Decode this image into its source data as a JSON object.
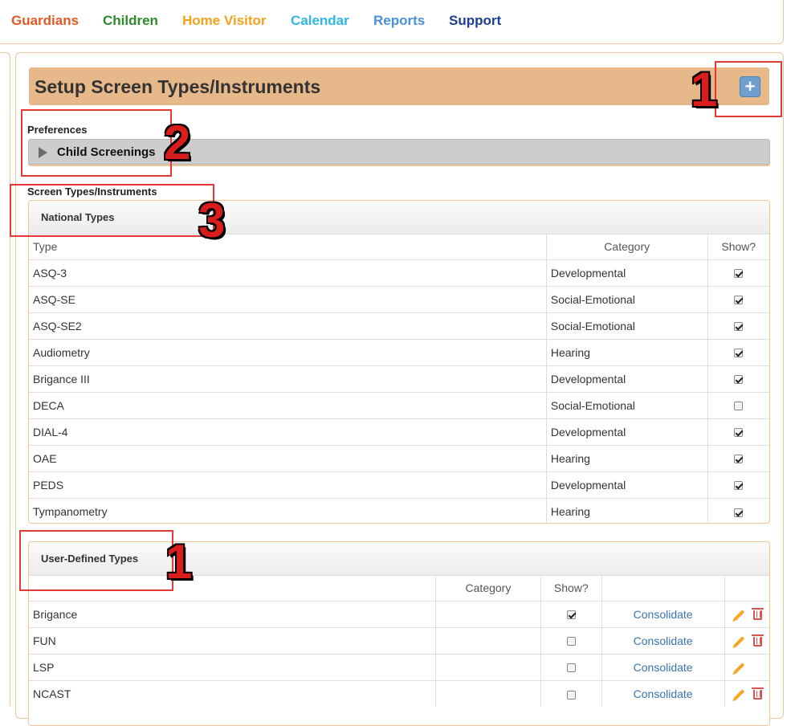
{
  "nav": {
    "items": [
      {
        "label": "Guardians",
        "color": "#e05a25"
      },
      {
        "label": "Children",
        "color": "#2b8a2b"
      },
      {
        "label": "Home Visitor",
        "color": "#f5a21b"
      },
      {
        "label": "Calendar",
        "color": "#2fb5e6"
      },
      {
        "label": "Reports",
        "color": "#4a90d9"
      },
      {
        "label": "Support",
        "color": "#1c3f8f"
      }
    ]
  },
  "header": {
    "title": "Setup Screen Types/Instruments",
    "add_icon": "+"
  },
  "preferences": {
    "label": "Preferences",
    "collapse_label": "Child Screenings"
  },
  "screen_types_label": "Screen Types/Instruments",
  "national": {
    "title": "National Types",
    "columns": [
      "Type",
      "Category",
      "Show?"
    ],
    "rows": [
      {
        "type": "ASQ-3",
        "category": "Developmental",
        "show": true
      },
      {
        "type": "ASQ-SE",
        "category": "Social-Emotional",
        "show": true
      },
      {
        "type": "ASQ-SE2",
        "category": "Social-Emotional",
        "show": true
      },
      {
        "type": "Audiometry",
        "category": "Hearing",
        "show": true
      },
      {
        "type": "Brigance III",
        "category": "Developmental",
        "show": true
      },
      {
        "type": "DECA",
        "category": "Social-Emotional",
        "show": false
      },
      {
        "type": "DIAL-4",
        "category": "Developmental",
        "show": true
      },
      {
        "type": "OAE",
        "category": "Hearing",
        "show": true
      },
      {
        "type": "PEDS",
        "category": "Developmental",
        "show": true
      },
      {
        "type": "Tympanometry",
        "category": "Hearing",
        "show": true
      }
    ]
  },
  "user_defined": {
    "title": "User-Defined Types",
    "columns": [
      "",
      "Category",
      "Show?",
      "",
      ""
    ],
    "rows": [
      {
        "type": "Brigance",
        "category": "",
        "show": true,
        "action": "Consolidate",
        "deletable": true
      },
      {
        "type": "FUN",
        "category": "",
        "show": false,
        "action": "Consolidate",
        "deletable": true
      },
      {
        "type": "LSP",
        "category": "",
        "show": false,
        "action": "Consolidate",
        "deletable": false
      },
      {
        "type": "NCAST",
        "category": "",
        "show": false,
        "action": "Consolidate",
        "deletable": true
      }
    ]
  },
  "annotations": {
    "labels": [
      "1",
      "2",
      "3",
      "1"
    ],
    "color": "#e53935"
  }
}
